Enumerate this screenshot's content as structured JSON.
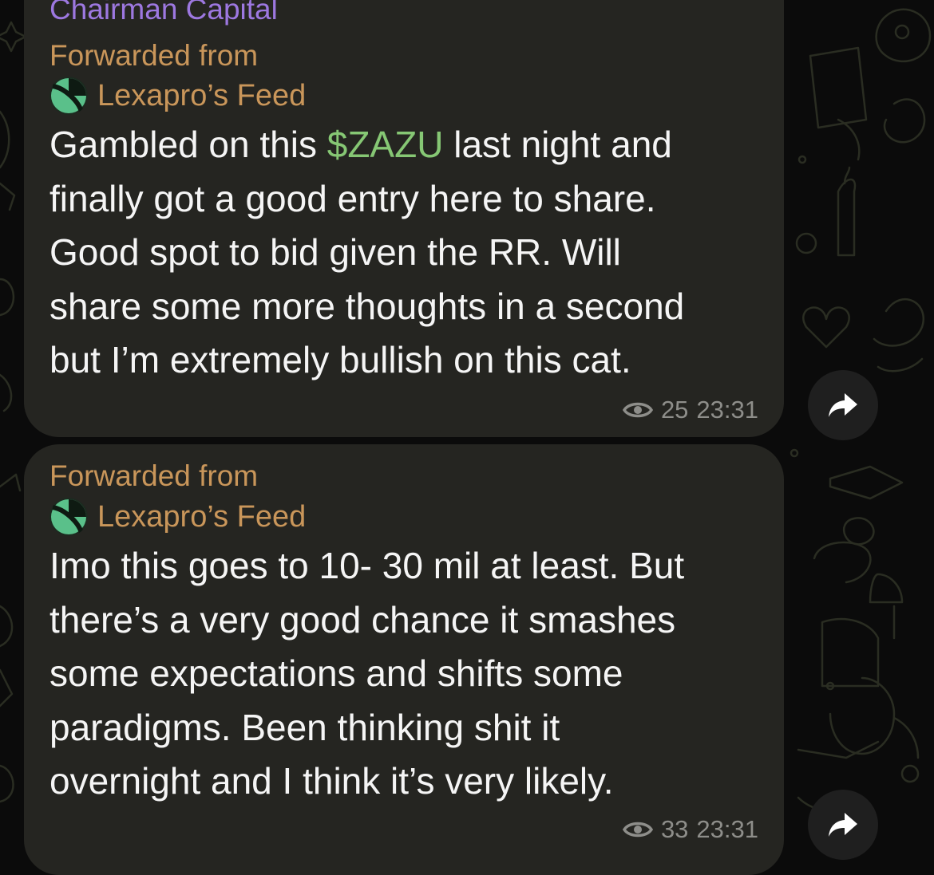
{
  "messages": [
    {
      "sender": "Chairman Capital",
      "forwarded_label": "Forwarded from",
      "forwarded_source": "Lexapro’s Feed",
      "lines": [
        {
          "before": "Gambled on this ",
          "ticker": "$ZAZU",
          "after": " last night and"
        },
        {
          "text": "finally got a good entry here to share."
        },
        {
          "text": "Good spot to bid given the RR. Will"
        },
        {
          "text": "share some more thoughts in a second"
        },
        {
          "text": "but I’m extremely bullish on this cat."
        }
      ],
      "views": "25",
      "time": "23:31"
    },
    {
      "forwarded_label": "Forwarded from",
      "forwarded_source": "Lexapro’s Feed",
      "lines": [
        {
          "text": "Imo this goes to 10- 30 mil at least. But"
        },
        {
          "text": "there’s a very good chance it smashes"
        },
        {
          "text": "some expectations and shifts some"
        },
        {
          "text": "paradigms. Been thinking shit it"
        },
        {
          "text": "overnight and I think it’s very likely."
        }
      ],
      "views": "33",
      "time": "23:31"
    }
  ],
  "icons": {
    "views": "eye-icon",
    "share": "share-arrow-icon",
    "avatar": "channel-avatar"
  },
  "colors": {
    "bubble": "#252521",
    "sender": "#9d78e0",
    "forwarded": "#c9965a",
    "ticker": "#86c774",
    "text": "#f5f5f5",
    "meta": "#8e8e8a"
  }
}
